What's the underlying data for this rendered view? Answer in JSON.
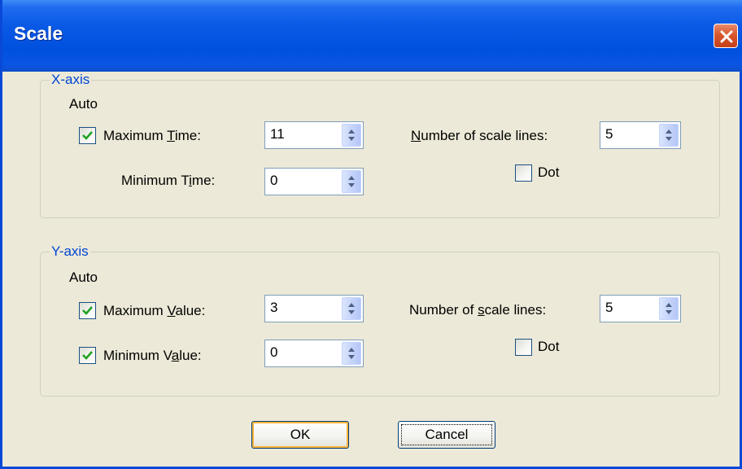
{
  "window": {
    "title": "Scale"
  },
  "xaxis": {
    "legend": "X-axis",
    "auto_label": "Auto",
    "max_checked": true,
    "max_label_pre": "Maximum ",
    "max_label_mn": "T",
    "max_label_post": "ime:",
    "max_value": "11",
    "min_label_pre": "Minimum T",
    "min_label_mn": "i",
    "min_label_post": "me:",
    "min_value": "0",
    "scale_label_pre": "",
    "scale_label_mn": "N",
    "scale_label_post": "umber of scale lines:",
    "scale_value": "5",
    "dot_label": "Dot",
    "dot_checked": false
  },
  "yaxis": {
    "legend": "Y-axis",
    "auto_label": "Auto",
    "max_checked": true,
    "max_label_pre": "Maximum ",
    "max_label_mn": "V",
    "max_label_post": "alue:",
    "max_value": "3",
    "min_checked": true,
    "min_label_pre": "Minimum V",
    "min_label_mn": "a",
    "min_label_post": "lue:",
    "min_value": "0",
    "scale_label_pre": "Number of ",
    "scale_label_mn": "s",
    "scale_label_post": "cale lines:",
    "scale_value": "5",
    "dot_label": "Dot",
    "dot_checked": false
  },
  "buttons": {
    "ok": "OK",
    "cancel": "Cancel"
  },
  "icons": {
    "close": "close-icon",
    "check": "checkmark-icon",
    "spin": "spin-updown-icon"
  },
  "colors": {
    "titlebar": "#0050de",
    "group_legend": "#0046d5",
    "check": "#21a121",
    "close": "#d9572d"
  }
}
